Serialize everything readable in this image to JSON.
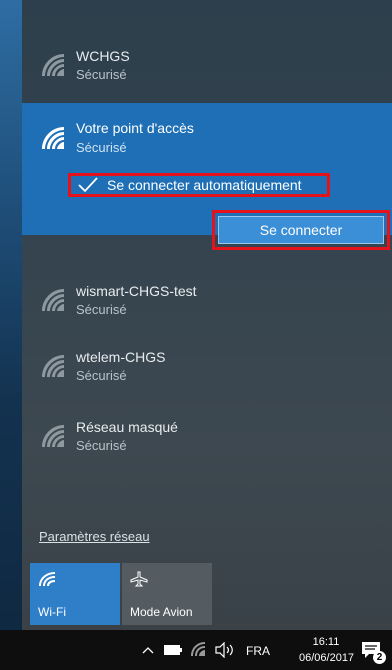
{
  "networks": {
    "wchgs": {
      "name": "WCHGS",
      "status": "Sécurisé"
    },
    "selected": {
      "name": "Votre point d'accès",
      "status": "Sécurisé",
      "auto_connect_label": "Se connecter automatiquement",
      "connect_button": "Se connecter"
    },
    "wismart": {
      "name": "wismart-CHGS-test",
      "status": "Sécurisé"
    },
    "wtelem": {
      "name": "wtelem-CHGS",
      "status": "Sécurisé"
    },
    "hidden": {
      "name": "Réseau masqué",
      "status": "Sécurisé"
    }
  },
  "settings_link": "Paramètres réseau",
  "tiles": {
    "wifi": "Wi-Fi",
    "avion": "Mode Avion"
  },
  "taskbar": {
    "language": "FRA",
    "time": "16:11",
    "date": "06/06/2017",
    "notification_count": "2"
  },
  "colors": {
    "accent": "#1e6fb6",
    "highlight_border": "#e3121b",
    "wifi_tile": "#2f7fc8"
  },
  "icons": [
    "wifi-secured-icon",
    "checkmark-icon",
    "airplane-icon",
    "chevron-up-icon",
    "battery-icon",
    "wifi-tray-icon",
    "volume-icon",
    "notification-icon"
  ]
}
